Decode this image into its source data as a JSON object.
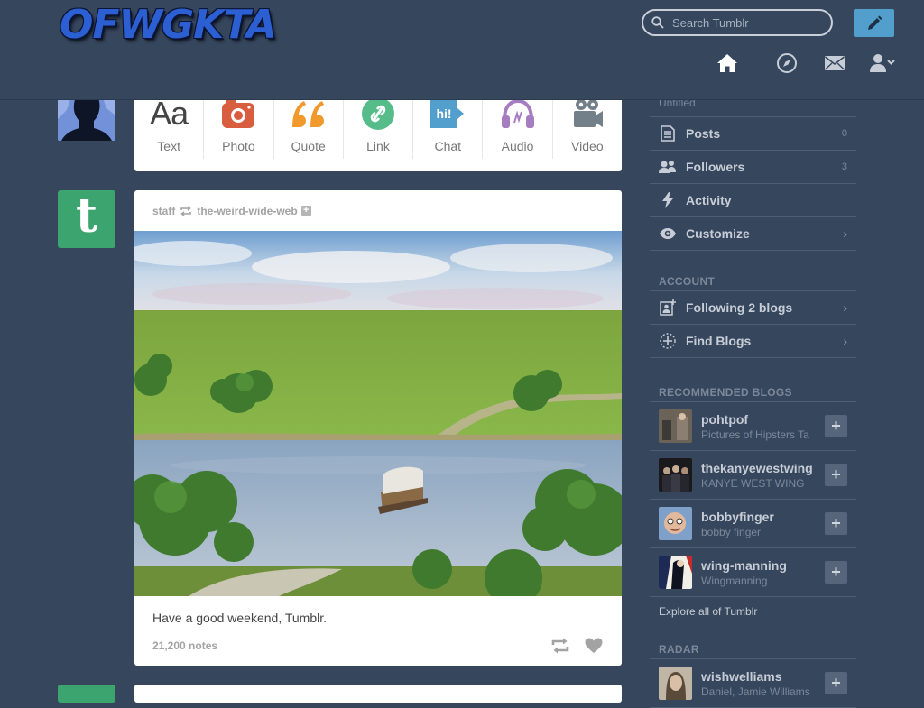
{
  "header": {
    "logo_text": "OFWGKTA",
    "search_placeholder": "Search Tumblr",
    "compose_icon": "pencil-icon",
    "nav_icons": [
      "home-icon",
      "compass-icon",
      "mail-icon",
      "account-icon"
    ]
  },
  "post_types": [
    {
      "label": "Text",
      "icon": "text-icon",
      "color": "#444444"
    },
    {
      "label": "Photo",
      "icon": "camera-icon",
      "color": "#d95e40"
    },
    {
      "label": "Quote",
      "icon": "quote-icon",
      "color": "#f2992e"
    },
    {
      "label": "Link",
      "icon": "link-icon",
      "color": "#56bc8a"
    },
    {
      "label": "Chat",
      "icon": "chat-icon",
      "color": "#529ecc"
    },
    {
      "label": "Audio",
      "icon": "headphones-icon",
      "color": "#a77dc2"
    },
    {
      "label": "Video",
      "icon": "video-camera-icon",
      "color": "#748089"
    }
  ],
  "post": {
    "author": "staff",
    "reblogged_from": "the-weird-wide-web",
    "caption": "Have a good weekend, Tumblr.",
    "notes": "21,200 notes"
  },
  "sidebar": {
    "blog_title": "Untitled",
    "blog_items": [
      {
        "label": "Posts",
        "count": "0",
        "icon": "posts-icon"
      },
      {
        "label": "Followers",
        "count": "3",
        "icon": "followers-icon"
      },
      {
        "label": "Activity",
        "count": "",
        "icon": "activity-icon"
      },
      {
        "label": "Customize",
        "count": "",
        "icon": "eye-icon"
      }
    ],
    "account_heading": "ACCOUNT",
    "account_items": [
      {
        "label": "Following 2 blogs",
        "icon": "following-icon"
      },
      {
        "label": "Find Blogs",
        "icon": "find-blogs-icon"
      }
    ],
    "recommended_heading": "RECOMMENDED BLOGS",
    "recommended": [
      {
        "name": "pohtpof",
        "subtitle": "Pictures of Hipsters Ta"
      },
      {
        "name": "thekanyewestwing",
        "subtitle": "KANYE WEST WING"
      },
      {
        "name": "bobbyfinger",
        "subtitle": "bobby finger"
      },
      {
        "name": "wing-manning",
        "subtitle": "Wingmanning"
      }
    ],
    "explore_label": "Explore all of Tumblr",
    "radar_heading": "RADAR",
    "radar": {
      "name": "wishwelliams",
      "subtitle": "Daniel, Jamie Williams"
    }
  },
  "colors": {
    "background": "#36465d",
    "accent": "#529ecc",
    "tumblr_green": "#3ca46e"
  }
}
